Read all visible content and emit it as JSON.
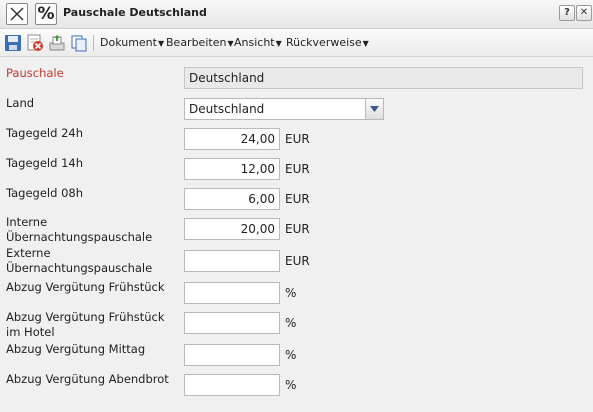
{
  "window": {
    "title": "Pauschale Deutschland",
    "percent_icon_glyph": "%",
    "help_button": "?",
    "close_button": "✕"
  },
  "toolbar": {
    "icons": [
      "save-icon",
      "delete-icon",
      "export-icon",
      "copy-icon"
    ],
    "menus": [
      "Dokument",
      "Bearbeiten",
      "Ansicht",
      "Rückverweise"
    ]
  },
  "form": {
    "pauschale": {
      "label": "Pauschale",
      "value": "Deutschland"
    },
    "land": {
      "label": "Land",
      "value": "Deutschland"
    },
    "tagegeld24": {
      "label": "Tagegeld 24h",
      "value": "24,00",
      "unit": "EUR"
    },
    "tagegeld14": {
      "label": "Tagegeld 14h",
      "value": "12,00",
      "unit": "EUR"
    },
    "tagegeld08": {
      "label": "Tagegeld 08h",
      "value": "6,00",
      "unit": "EUR"
    },
    "intern": {
      "label_line1": "Interne",
      "label_line2": "Übernachtungspauschale",
      "value": "20,00",
      "unit": "EUR"
    },
    "extern": {
      "label_line1": "Externe",
      "label_line2": "Übernachtungspauschale",
      "value": "",
      "unit": "EUR"
    },
    "fruehstueck": {
      "label": "Abzug Vergütung Frühstück",
      "value": "",
      "unit": "%"
    },
    "fruehstueck_hotel": {
      "label_line1": "Abzug Vergütung Frühstück",
      "label_line2": "im Hotel",
      "value": "",
      "unit": "%"
    },
    "mittag": {
      "label": "Abzug Vergütung Mittag",
      "value": "",
      "unit": "%"
    },
    "abendbrot": {
      "label": "Abzug Vergütung Abendbrot",
      "value": "",
      "unit": "%"
    }
  }
}
